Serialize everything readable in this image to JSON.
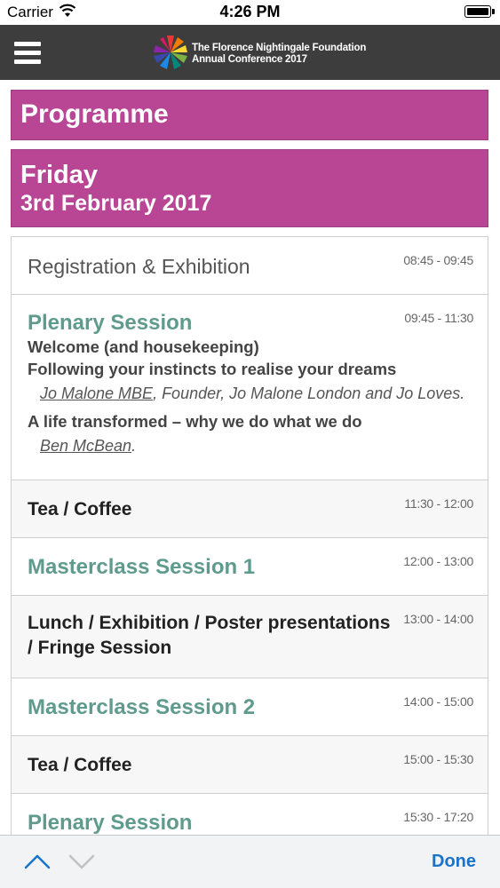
{
  "status_bar": {
    "carrier": "Carrier",
    "time": "4:26 PM"
  },
  "header": {
    "logo_line1": "The Florence Nightingale Foundation",
    "logo_line2": "Annual Conference 2017"
  },
  "page": {
    "title": "Programme",
    "day_name": "Friday",
    "day_date": "3rd February 2017"
  },
  "sessions": [
    {
      "time": "08:45 - 09:45",
      "title": "Registration & Exhibition"
    },
    {
      "time": "09:45 - 11:30",
      "title": "Plenary Session",
      "line1": "Welcome (and housekeeping)",
      "line2": "Following your instincts to realise your dreams",
      "speaker1_name": "Jo Malone MBE",
      "speaker1_detail": ", Founder, Jo Malone London and Jo Loves.",
      "line3": "A life transformed – why we do what we do",
      "speaker2_name": "Ben McBean",
      "speaker2_detail": "."
    },
    {
      "time": "11:30 - 12:00",
      "title": "Tea / Coffee"
    },
    {
      "time": "12:00 - 13:00",
      "title": "Masterclass Session 1"
    },
    {
      "time": "13:00 - 14:00",
      "title": "Lunch / Exhibition / Poster presentations / Fringe Session"
    },
    {
      "time": "14:00 - 15:00",
      "title": "Masterclass Session 2"
    },
    {
      "time": "15:00 - 15:30",
      "title": "Tea / Coffee"
    },
    {
      "time": "15:30 - 17:20",
      "title": "Plenary Session"
    }
  ],
  "toolbar": {
    "done_label": "Done"
  },
  "colors": {
    "header_bg": "#3d3d3d",
    "programme_accent": "#b84695",
    "session_title_teal": "#5f9b8c",
    "toolbar_link": "#1a73c8"
  }
}
